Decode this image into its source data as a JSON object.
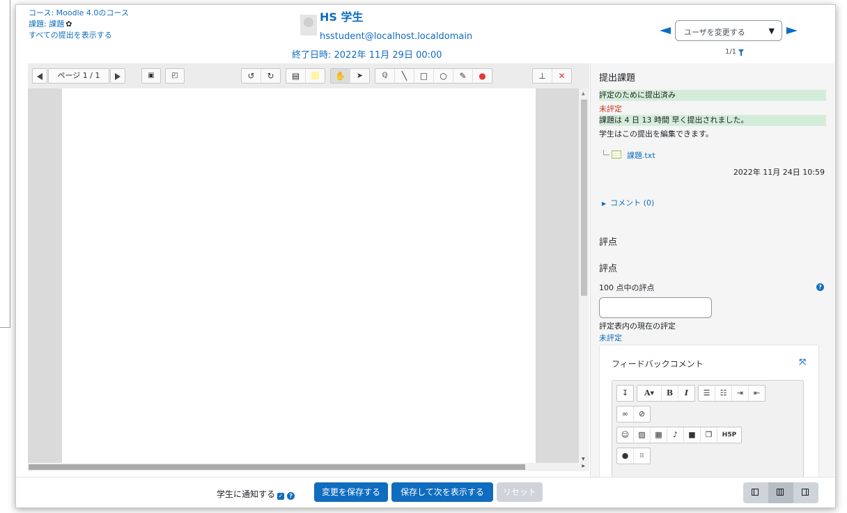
{
  "header": {
    "course_link": "コース: Moodle 4.0のコース",
    "assignment_link": "課題: 課題",
    "view_all_link": "すべての提出を表示する",
    "user_name": "HS 学生",
    "user_email": "hsstudent@localhost.localdomain",
    "due_date": "終了日時: 2022年 11月 29日 00:00",
    "change_user_placeholder": "ユーザを変更する",
    "pager": "1/1"
  },
  "toolbar": {
    "page_label": "ページ 1 / 1",
    "icons": [
      "prev-page-icon",
      "next-page-icon",
      "search-comments-icon",
      "expand-comments-icon",
      "rotate-left-icon",
      "rotate-right-icon",
      "comment-icon",
      "comment-color-icon",
      "pan-icon",
      "select-icon",
      "search-icon",
      "line-icon",
      "rectangle-icon",
      "oval-icon",
      "pen-icon",
      "highlight-icon",
      "stamp-icon",
      "delete-icon"
    ]
  },
  "submission": {
    "title": "提出課題",
    "status_submitted": "評定のために提出済み",
    "status_grading": "未評定",
    "early_message": "課題は 4 日 13 時間 早く提出されました。",
    "can_edit": "学生はこの提出を編集できます。",
    "file_name": "課題.txt",
    "file_date": "2022年 11月 24日 10:59",
    "comments_link": "コメント (0)"
  },
  "grade": {
    "heading1": "評点",
    "heading2": "評点",
    "grade_label": "100 点中の評点",
    "grade_value": "",
    "current_label": "評定表内の現在の評定",
    "current_value": "未評定"
  },
  "feedback": {
    "title": "フィードバックコメント"
  },
  "footer": {
    "notify_label": "学生に通知する",
    "save_label": "変更を保存する",
    "save_next_label": "保存して次を表示する",
    "reset_label": "リセット"
  },
  "colors": {
    "primary": "#0f6cbf",
    "success_bg": "#d4edda",
    "danger": "#ca3120",
    "secondary": "#ced4da"
  }
}
